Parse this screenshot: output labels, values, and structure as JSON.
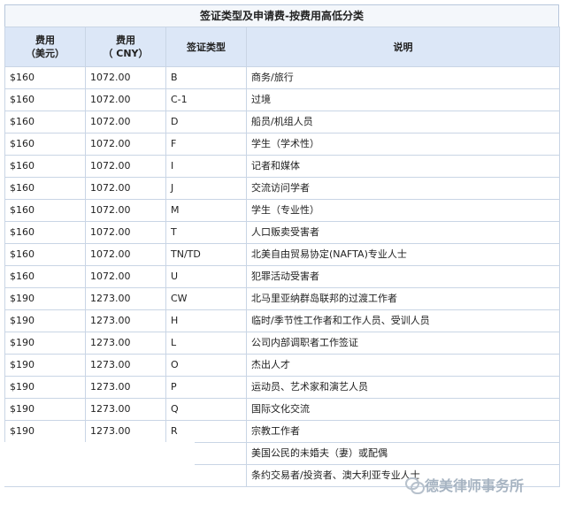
{
  "title": "签证类型及申请费-按费用高低分类",
  "headers": {
    "fee_usd": "费用\n（美元）",
    "fee_cny": "费用\n（ CNY）",
    "visa_type": "签证类型",
    "description": "说明"
  },
  "rows": [
    {
      "usd": "$160",
      "cny": "1072.00",
      "type": "B",
      "desc": "商务/旅行"
    },
    {
      "usd": "$160",
      "cny": "1072.00",
      "type": "C-1",
      "desc": "过境"
    },
    {
      "usd": "$160",
      "cny": "1072.00",
      "type": "D",
      "desc": "船员/机组人员"
    },
    {
      "usd": "$160",
      "cny": "1072.00",
      "type": "F",
      "desc": "学生（学术性）"
    },
    {
      "usd": "$160",
      "cny": "1072.00",
      "type": "I",
      "desc": "记者和媒体"
    },
    {
      "usd": "$160",
      "cny": "1072.00",
      "type": "J",
      "desc": "交流访问学者"
    },
    {
      "usd": "$160",
      "cny": "1072.00",
      "type": "M",
      "desc": "学生（专业性）"
    },
    {
      "usd": "$160",
      "cny": "1072.00",
      "type": "T",
      "desc": "人口贩卖受害者"
    },
    {
      "usd": "$160",
      "cny": "1072.00",
      "type": "TN/TD",
      "desc": "北美自由贸易协定(NAFTA)专业人士"
    },
    {
      "usd": "$160",
      "cny": "1072.00",
      "type": "U",
      "desc": "犯罪活动受害者"
    },
    {
      "usd": "$190",
      "cny": "1273.00",
      "type": "CW",
      "desc": "北马里亚纳群岛联邦的过渡工作者"
    },
    {
      "usd": "$190",
      "cny": "1273.00",
      "type": "H",
      "desc": "临时/季节性工作者和工作人员、受训人员"
    },
    {
      "usd": "$190",
      "cny": "1273.00",
      "type": "L",
      "desc": "公司内部调职者工作签证"
    },
    {
      "usd": "$190",
      "cny": "1273.00",
      "type": "O",
      "desc": "杰出人才"
    },
    {
      "usd": "$190",
      "cny": "1273.00",
      "type": "P",
      "desc": "运动员、艺术家和演艺人员"
    },
    {
      "usd": "$190",
      "cny": "1273.00",
      "type": "Q",
      "desc": "国际文化交流"
    },
    {
      "usd": "$190",
      "cny": "1273.00",
      "type": "R",
      "desc": "宗教工作者"
    },
    {
      "usd": "",
      "cny": "",
      "type": "",
      "desc": "美国公民的未婚夫（妻）或配偶"
    },
    {
      "usd": "",
      "cny": "",
      "type": "",
      "desc": "条约交易者/投资者、澳大利亚专业人士"
    }
  ],
  "watermark": {
    "left_text": "",
    "right_text": "德美律师事务所"
  }
}
